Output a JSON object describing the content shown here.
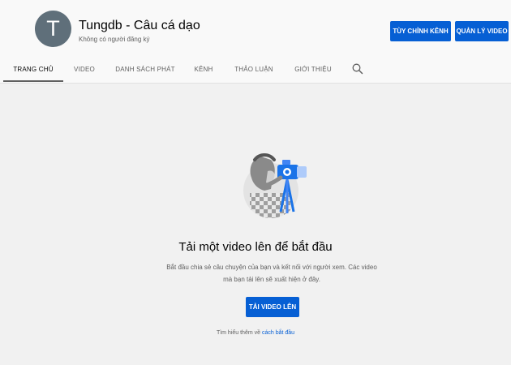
{
  "channel": {
    "avatar_letter": "T",
    "title": "Tungdb - Câu cá dạo",
    "subscribers": "Không có người đăng ký"
  },
  "actions": {
    "customize_label": "TÙY CHỈNH KÊNH",
    "manage_label": "QUẢN LÝ VIDEO"
  },
  "tabs": [
    {
      "label": "TRANG CHỦ",
      "active": true
    },
    {
      "label": "VIDEO",
      "active": false
    },
    {
      "label": "DANH SÁCH PHÁT",
      "active": false
    },
    {
      "label": "KÊNH",
      "active": false
    },
    {
      "label": "THẢO LUẬN",
      "active": false
    },
    {
      "label": "GIỚI THIỆU",
      "active": false
    }
  ],
  "tab_icons": {
    "search": "search-icon"
  },
  "empty_state": {
    "title": "Tải một video lên để bắt đầu",
    "description": "Bắt đầu chia sẻ câu chuyện của bạn và kết nối với người xem. Các video mà bạn tải lên sẽ xuất hiện ở đây.",
    "upload_label": "TẢI VIDEO LÊN",
    "learn_more_prefix": "Tìm hiểu thêm về",
    "learn_more_link": "cách bắt đầu"
  },
  "colors": {
    "accent": "#065fd4",
    "avatar": "#5f6f7a",
    "page_bg": "#f1f1f1"
  }
}
